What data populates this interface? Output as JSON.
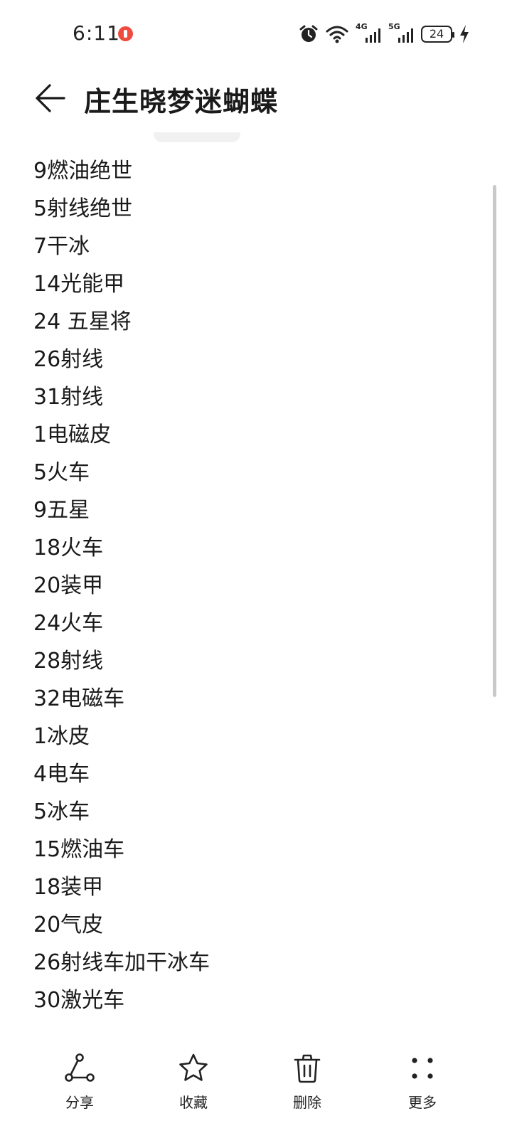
{
  "status_bar": {
    "time": "6:11",
    "net1": "4G",
    "net2": "5G",
    "battery": "24",
    "icons": [
      "recording-dot-icon",
      "alarm-icon",
      "wifi-icon",
      "signal-4g-icon",
      "signal-5g-icon",
      "battery-icon",
      "charging-bolt-icon"
    ]
  },
  "header": {
    "title": "庄生晓梦迷蝴蝶",
    "back_icon": "back-arrow-icon"
  },
  "note": {
    "lines": [
      "9燃油绝世",
      "5射线绝世",
      "7干冰",
      "14光能甲",
      "24 五星将",
      "26射线",
      "31射线",
      "1电磁皮",
      "5火车",
      "9五星",
      "18火车",
      "20装甲",
      "24火车",
      "28射线",
      "32电磁车",
      "1冰皮",
      "4电车",
      "5冰车",
      "15燃油车",
      "18装甲",
      "20气皮",
      "26射线车加干冰车",
      "30激光车"
    ]
  },
  "toolbar": {
    "share": "分享",
    "favorite": "收藏",
    "delete": "删除",
    "more": "更多"
  },
  "colors": {
    "background": "#ffffff",
    "text": "#1a1a1a",
    "recording_dot": "#ef4b3f",
    "scrollbar": "#c9c9c9"
  }
}
